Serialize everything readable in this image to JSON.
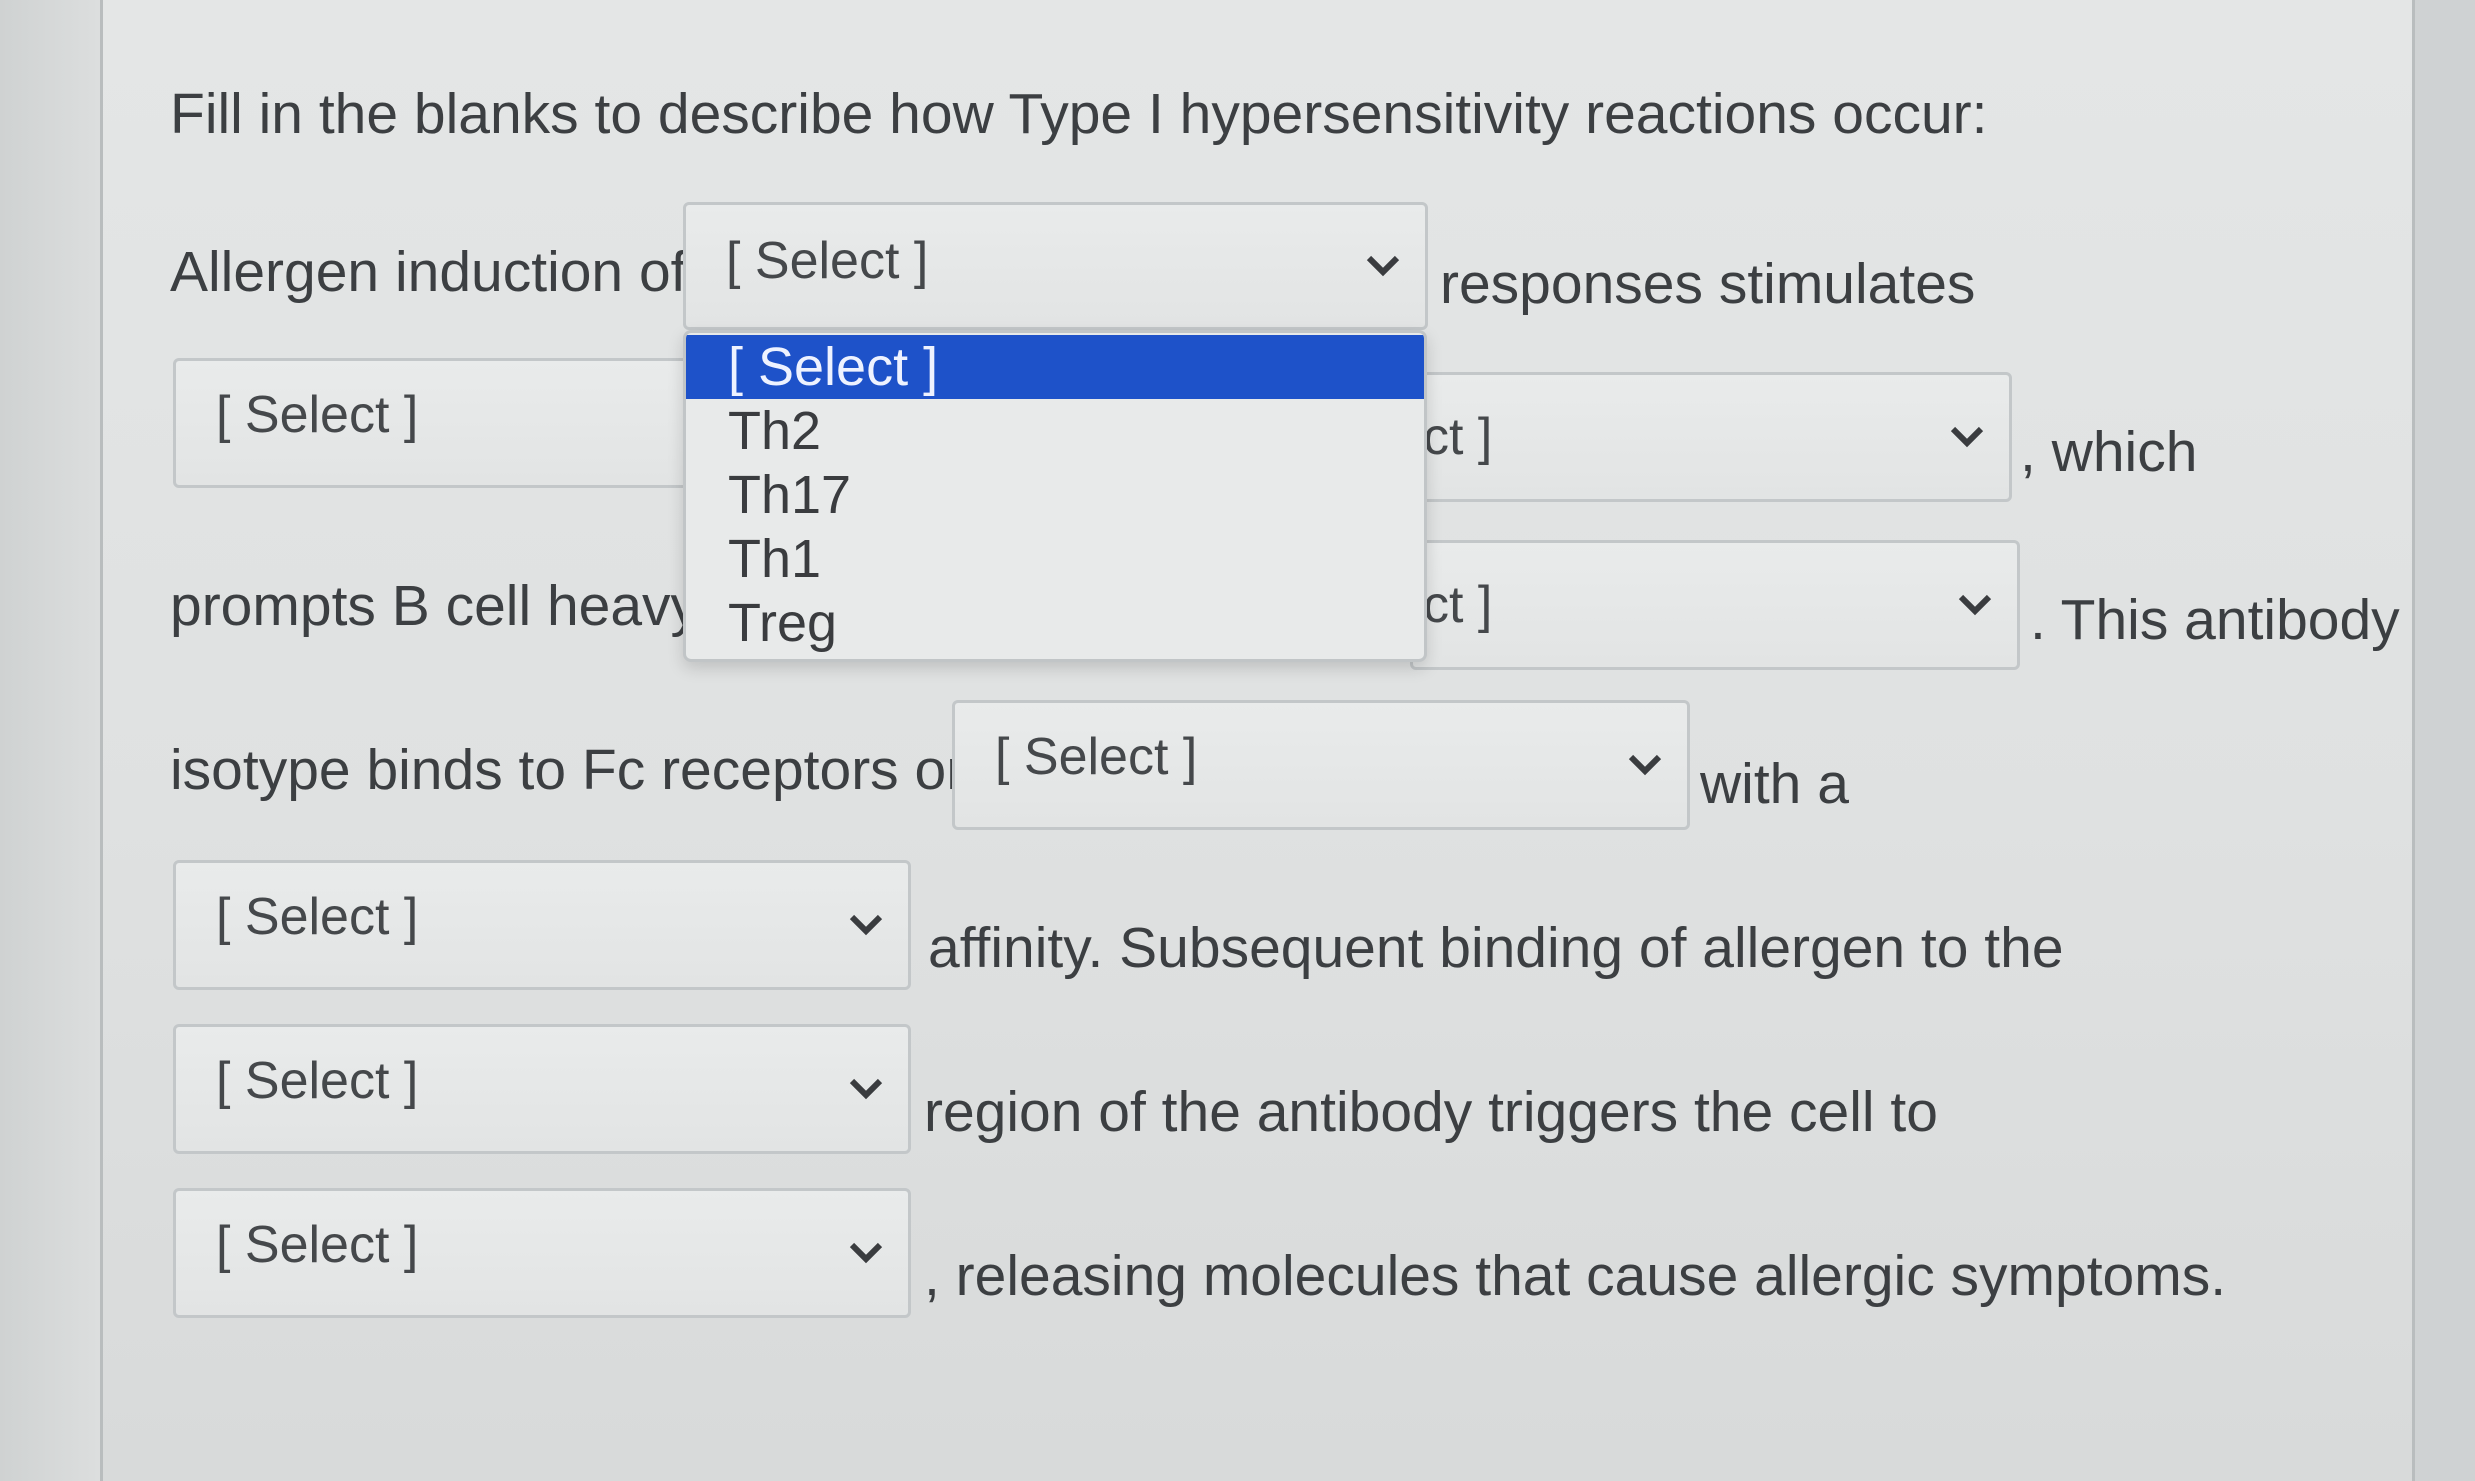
{
  "question": {
    "title": "Fill in the blanks to describe how Type I hypersensitivity reactions occur:"
  },
  "sentence": {
    "t1": "Allergen induction of",
    "t2": "responses stimulates",
    "t3": ", which",
    "t4": "prompts B cell heavy-",
    "t5": ". This antibody",
    "t6": "isotype binds to Fc receptors on",
    "t7": "with a",
    "t8": "affinity. Subsequent binding of allergen to the",
    "t9": "region of the antibody triggers the cell to",
    "t10": ", releasing molecules that cause allergic symptoms."
  },
  "selects": {
    "s1": "[ Select ]",
    "s2": "[ Select ]",
    "s3_partial": "ct ]",
    "s4_partial": "ct ]",
    "s5": "[ Select ]",
    "s6": "[ Select ]",
    "s7": "[ Select ]",
    "s8": "[ Select ]"
  },
  "dropdown": {
    "options": [
      "[ Select ]",
      "Th2",
      "Th17",
      "Th1",
      "Treg"
    ],
    "highlighted_index": 0
  },
  "colors": {
    "highlight": "#1e52c9",
    "page_bg": "#e2e4e4"
  },
  "icons": {
    "select_chevron": "chevron-down-icon"
  }
}
